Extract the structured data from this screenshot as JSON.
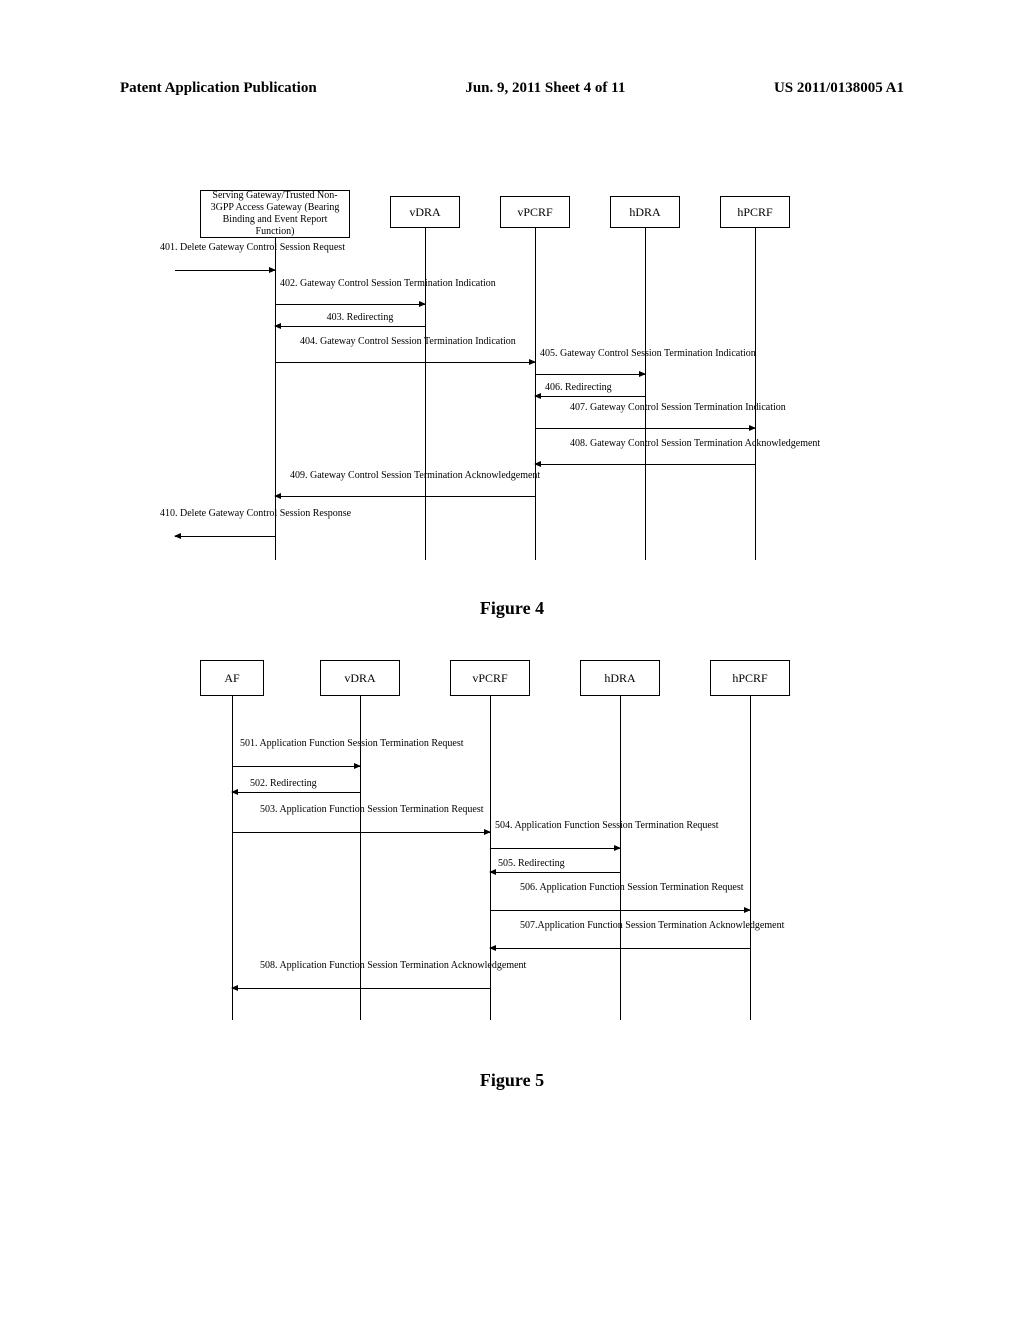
{
  "header": {
    "left": "Patent Application Publication",
    "center": "Jun. 9, 2011   Sheet 4 of 11",
    "right": "US 2011/0138005 A1"
  },
  "fig4": {
    "caption": "Figure 4",
    "boxes": {
      "sgw": "Serving Gateway/Trusted Non-3GPP Access Gateway (Bearing Binding and Event Report Function)",
      "vdra": "vDRA",
      "vpcrf": "vPCRF",
      "hdra": "hDRA",
      "hpcrf": "hPCRF"
    },
    "msgs": {
      "m401": "401. Delete Gateway Control Session Request",
      "m402": "402. Gateway Control Session Termination Indication",
      "m403": "403. Redirecting",
      "m404": "404. Gateway Control Session Termination Indication",
      "m405": "405. Gateway Control Session Termination Indication",
      "m406": "406. Redirecting",
      "m407": "407. Gateway Control Session Termination Indication",
      "m408": "408. Gateway Control Session Termination Acknowledgement",
      "m409": "409. Gateway Control Session Termination Acknowledgement",
      "m410": "410. Delete Gateway Control Session Response"
    }
  },
  "fig5": {
    "caption": "Figure 5",
    "boxes": {
      "af": "AF",
      "vdra": "vDRA",
      "vpcrf": "vPCRF",
      "hdra": "hDRA",
      "hpcrf": "hPCRF"
    },
    "msgs": {
      "m501": "501. Application Function Session Termination Request",
      "m502": "502. Redirecting",
      "m503": "503. Application Function Session Termination Request",
      "m504": "504. Application Function Session Termination Request",
      "m505": "505. Redirecting",
      "m506": "506. Application Function Session Termination Request",
      "m507": "507.Application Function Session Termination Acknowledgement",
      "m508": "508. Application Function Session Termination Acknowledgement"
    }
  }
}
